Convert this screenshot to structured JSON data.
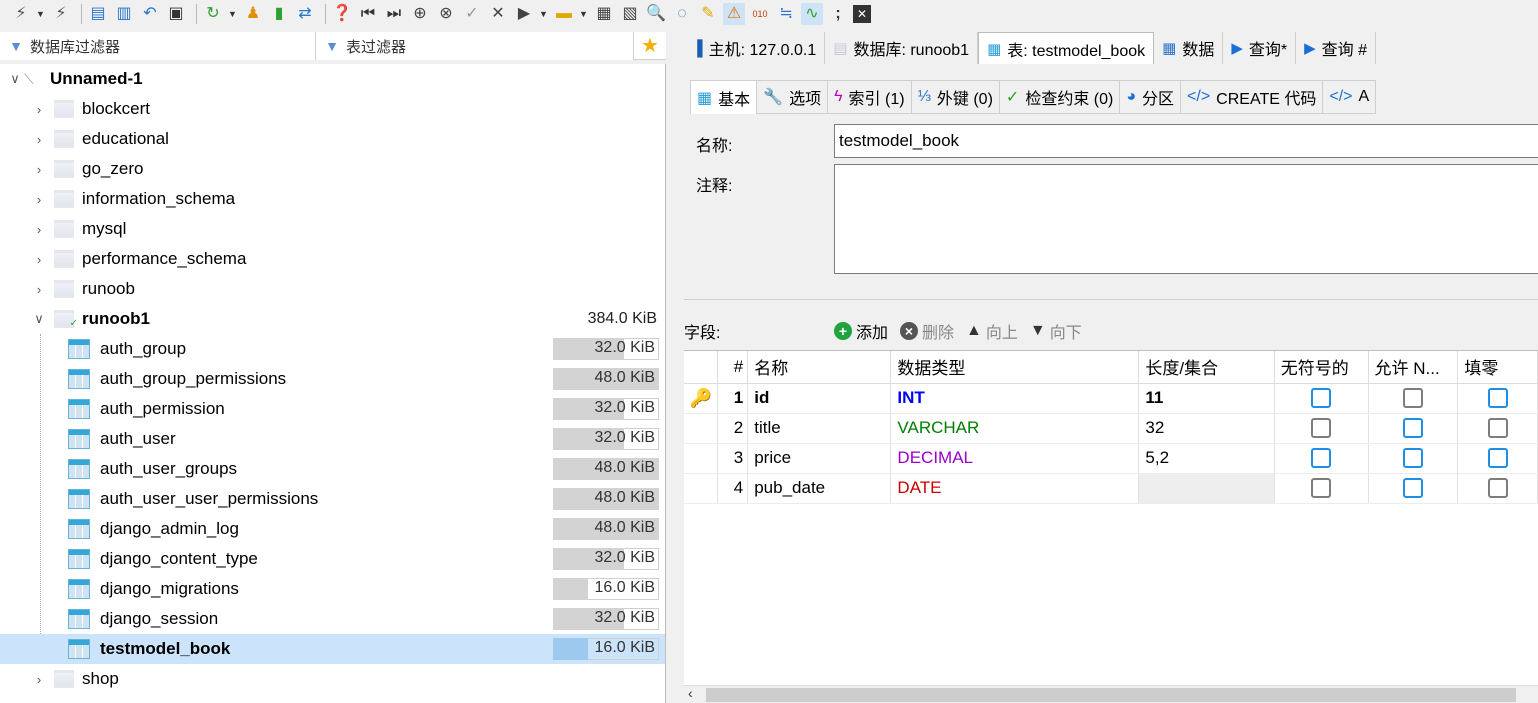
{
  "toolbar": {
    "icons": [
      "plug-icon",
      "dropdown",
      "disconnect-icon",
      "copy-icon",
      "paste-icon",
      "undo-icon",
      "print-icon",
      "refresh-icon",
      "dropdown",
      "users-icon",
      "export-icon",
      "transfer-icon",
      "help-icon",
      "first-icon",
      "last-icon",
      "add-icon",
      "remove-icon",
      "check-icon",
      "cancel-icon",
      "run-icon",
      "dropdown",
      "folder-icon",
      "dropdown",
      "save-icon",
      "save-as-icon",
      "find-icon",
      "find-replace-icon",
      "clear-icon",
      "warning-icon",
      "binary-icon",
      "wrap-icon",
      "sync-icon",
      "semicolon-icon",
      "close-icon"
    ]
  },
  "filters": {
    "db_placeholder": "数据库过滤器",
    "table_placeholder": "表过滤器"
  },
  "tree": {
    "session": "Unnamed-1",
    "databases_before": [
      "blockcert",
      "educational",
      "go_zero",
      "information_schema",
      "mysql",
      "performance_schema",
      "runoob"
    ],
    "open_db": {
      "name": "runoob1",
      "size": "384.0 KiB"
    },
    "tables": [
      {
        "name": "auth_group",
        "size": "32.0 KiB",
        "fill": 0.67
      },
      {
        "name": "auth_group_permissions",
        "size": "48.0 KiB",
        "fill": 1.0
      },
      {
        "name": "auth_permission",
        "size": "32.0 KiB",
        "fill": 0.67
      },
      {
        "name": "auth_user",
        "size": "32.0 KiB",
        "fill": 0.67
      },
      {
        "name": "auth_user_groups",
        "size": "48.0 KiB",
        "fill": 1.0
      },
      {
        "name": "auth_user_user_permissions",
        "size": "48.0 KiB",
        "fill": 1.0
      },
      {
        "name": "django_admin_log",
        "size": "48.0 KiB",
        "fill": 1.0
      },
      {
        "name": "django_content_type",
        "size": "32.0 KiB",
        "fill": 0.67
      },
      {
        "name": "django_migrations",
        "size": "16.0 KiB",
        "fill": 0.33
      },
      {
        "name": "django_session",
        "size": "32.0 KiB",
        "fill": 0.67
      },
      {
        "name": "testmodel_book",
        "size": "16.0 KiB",
        "fill": 0.33,
        "selected": true
      }
    ],
    "databases_after": [
      "shop"
    ]
  },
  "tabs": [
    {
      "label": "主机: 127.0.0.1",
      "icon": "host-icon"
    },
    {
      "label": "数据库: runoob1",
      "icon": "database-icon"
    },
    {
      "label": "表: testmodel_book",
      "icon": "table-icon",
      "active": true
    },
    {
      "label": "数据",
      "icon": "grid-icon"
    },
    {
      "label": "查询*",
      "icon": "play-icon"
    },
    {
      "label": "查询 #",
      "icon": "play-icon"
    }
  ],
  "subtabs": [
    {
      "label": "基本",
      "icon": "table-icon",
      "active": true
    },
    {
      "label": "选项",
      "icon": "wrench-icon"
    },
    {
      "label": "索引 (1)",
      "icon": "lightning-icon"
    },
    {
      "label": "外键 (0)",
      "icon": "foreign-key-icon"
    },
    {
      "label": "检查约束 (0)",
      "icon": "check-icon"
    },
    {
      "label": "分区",
      "icon": "pie-icon"
    },
    {
      "label": "CREATE 代码",
      "icon": "code-icon"
    },
    {
      "label": "A",
      "icon": "code-icon"
    }
  ],
  "form": {
    "name_label": "名称:",
    "name_value": "testmodel_book",
    "comment_label": "注释:",
    "comment_value": ""
  },
  "fields_bar": {
    "label": "字段:",
    "add": "添加",
    "delete": "删除",
    "up": "向上",
    "down": "向下"
  },
  "grid": {
    "headers": [
      "#",
      "名称",
      "数据类型",
      "长度/集合",
      "无符号的",
      "允许 N...",
      "填零"
    ],
    "rows": [
      {
        "n": "1",
        "name": "id",
        "type": "INT",
        "len": "11",
        "unsigned": false,
        "nullable": false,
        "zerofill": false,
        "key": true
      },
      {
        "n": "2",
        "name": "title",
        "type": "VARCHAR",
        "len": "32",
        "unsigned": false,
        "nullable": false,
        "zerofill": false
      },
      {
        "n": "3",
        "name": "price",
        "type": "DECIMAL",
        "len": "5,2",
        "unsigned": false,
        "nullable": false,
        "zerofill": false
      },
      {
        "n": "4",
        "name": "pub_date",
        "type": "DATE",
        "len": "",
        "unsigned": false,
        "nullable": true,
        "zerofill": false
      }
    ]
  },
  "colors": {
    "int": "#0000ff",
    "varchar": "#008000",
    "decimal": "#9900cc",
    "date": "#cc0000",
    "selection": "#cce4fb",
    "checkbox_blue": "#1e8ee6"
  }
}
